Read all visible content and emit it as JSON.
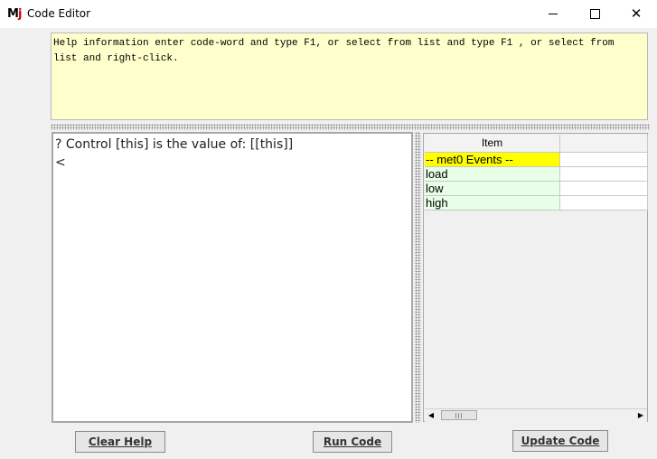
{
  "window": {
    "title": "Code Editor",
    "icon_glyph": "M",
    "icon_dot": "j",
    "minimize_icon": "minimize-icon",
    "maximize_icon": "maximize-icon",
    "close_glyph": "✕"
  },
  "help": {
    "text": "Help information enter code-word and type F1, or select from list and type F1 , or select from\nlist and right-click."
  },
  "editor": {
    "lines": [
      "? Control [this] is the value of: [[this]]",
      "<"
    ]
  },
  "table": {
    "columns": [
      "Item",
      ""
    ],
    "rows": [
      [
        "-- met0 Events --",
        ""
      ],
      [
        "load",
        ""
      ],
      [
        "low",
        ""
      ],
      [
        "high",
        ""
      ]
    ],
    "scroll_left_glyph": "◀",
    "scroll_right_glyph": "▶"
  },
  "buttons": {
    "clear_help": "Clear Help",
    "run_code": "Run Code",
    "update_code": "Update Code"
  },
  "colors": {
    "help_bg": "#ffffcc",
    "group_row": "#ffff00",
    "item_row": "#e6ffe6"
  }
}
